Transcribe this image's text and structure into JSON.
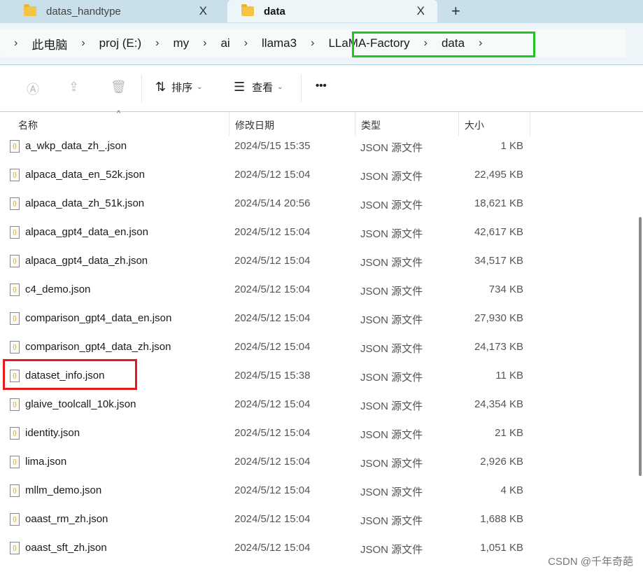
{
  "tabs": [
    {
      "label": "datas_handtype",
      "close": "X"
    },
    {
      "label": "data",
      "close": "X"
    }
  ],
  "new_tab": "+",
  "breadcrumb": [
    "此电脑",
    "proj (E:)",
    "my",
    "ai",
    "llama3",
    "LLaMA-Factory",
    "data"
  ],
  "toolbar": {
    "sort": "排序",
    "view": "查看",
    "more": "•••"
  },
  "columns": {
    "name": "名称",
    "date": "修改日期",
    "type": "类型",
    "size": "大小"
  },
  "files": [
    {
      "name": "a_wkp_data_zh_.json",
      "date": "2024/5/15 15:35",
      "type": "JSON 源文件",
      "size": "1 KB"
    },
    {
      "name": "alpaca_data_en_52k.json",
      "date": "2024/5/12 15:04",
      "type": "JSON 源文件",
      "size": "22,495 KB"
    },
    {
      "name": "alpaca_data_zh_51k.json",
      "date": "2024/5/14 20:56",
      "type": "JSON 源文件",
      "size": "18,621 KB"
    },
    {
      "name": "alpaca_gpt4_data_en.json",
      "date": "2024/5/12 15:04",
      "type": "JSON 源文件",
      "size": "42,617 KB"
    },
    {
      "name": "alpaca_gpt4_data_zh.json",
      "date": "2024/5/12 15:04",
      "type": "JSON 源文件",
      "size": "34,517 KB"
    },
    {
      "name": "c4_demo.json",
      "date": "2024/5/12 15:04",
      "type": "JSON 源文件",
      "size": "734 KB"
    },
    {
      "name": "comparison_gpt4_data_en.json",
      "date": "2024/5/12 15:04",
      "type": "JSON 源文件",
      "size": "27,930 KB"
    },
    {
      "name": "comparison_gpt4_data_zh.json",
      "date": "2024/5/12 15:04",
      "type": "JSON 源文件",
      "size": "24,173 KB"
    },
    {
      "name": "dataset_info.json",
      "date": "2024/5/15 15:38",
      "type": "JSON 源文件",
      "size": "11 KB"
    },
    {
      "name": "glaive_toolcall_10k.json",
      "date": "2024/5/12 15:04",
      "type": "JSON 源文件",
      "size": "24,354 KB"
    },
    {
      "name": "identity.json",
      "date": "2024/5/12 15:04",
      "type": "JSON 源文件",
      "size": "21 KB"
    },
    {
      "name": "lima.json",
      "date": "2024/5/12 15:04",
      "type": "JSON 源文件",
      "size": "2,926 KB"
    },
    {
      "name": "mllm_demo.json",
      "date": "2024/5/12 15:04",
      "type": "JSON 源文件",
      "size": "4 KB"
    },
    {
      "name": "oaast_rm_zh.json",
      "date": "2024/5/12 15:04",
      "type": "JSON 源文件",
      "size": "1,688 KB"
    },
    {
      "name": "oaast_sft_zh.json",
      "date": "2024/5/12 15:04",
      "type": "JSON 源文件",
      "size": "1,051 KB"
    }
  ],
  "watermark": "CSDN @千年奇葩"
}
